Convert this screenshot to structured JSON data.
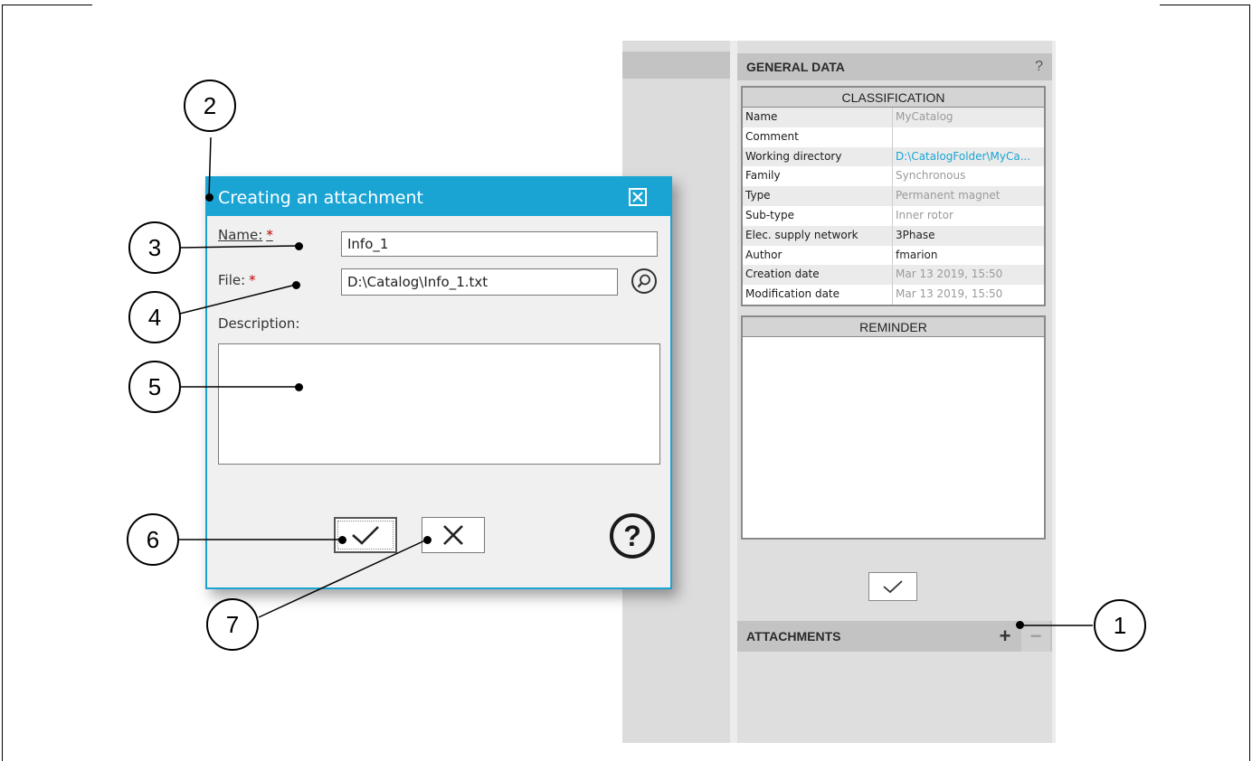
{
  "general_data": {
    "title": "GENERAL DATA",
    "help": "?",
    "classification": {
      "title": "CLASSIFICATION",
      "rows": [
        {
          "key": "Name",
          "value": "MyCatalog"
        },
        {
          "key": "Comment",
          "value": ""
        },
        {
          "key": "Working directory",
          "value": "D:\\CatalogFolder\\MyCa..."
        },
        {
          "key": "Family",
          "value": "Synchronous"
        },
        {
          "key": "Type",
          "value": "Permanent magnet"
        },
        {
          "key": "Sub-type",
          "value": "Inner rotor"
        },
        {
          "key": "Elec. supply network",
          "value": "3Phase"
        },
        {
          "key": "Author",
          "value": "fmarion"
        },
        {
          "key": "Creation date",
          "value": "Mar 13 2019, 15:50"
        },
        {
          "key": "Modification date",
          "value": "Mar 13 2019, 15:50"
        }
      ]
    },
    "reminder": {
      "title": "REMINDER"
    }
  },
  "attachments": {
    "title": "ATTACHMENTS",
    "add": "+",
    "remove": "−"
  },
  "dialog": {
    "title": "Creating an attachment",
    "name_label": "Name:",
    "name_value": "Info_1",
    "file_label": "File:",
    "file_value": "D:\\Catalog\\Info_1.txt",
    "required_mark": "*",
    "description_label": "Description:",
    "help": "?"
  },
  "callouts": [
    "1",
    "2",
    "3",
    "4",
    "5",
    "6",
    "7"
  ],
  "icons": {
    "close": "close-icon",
    "browse": "magnifier-icon",
    "ok": "checkmark-icon",
    "cancel": "cross-icon",
    "help": "question-icon"
  },
  "colors": {
    "accent": "#1aa4d4",
    "panel": "#dedede",
    "header": "#c3c3c3",
    "required": "#c00000"
  }
}
